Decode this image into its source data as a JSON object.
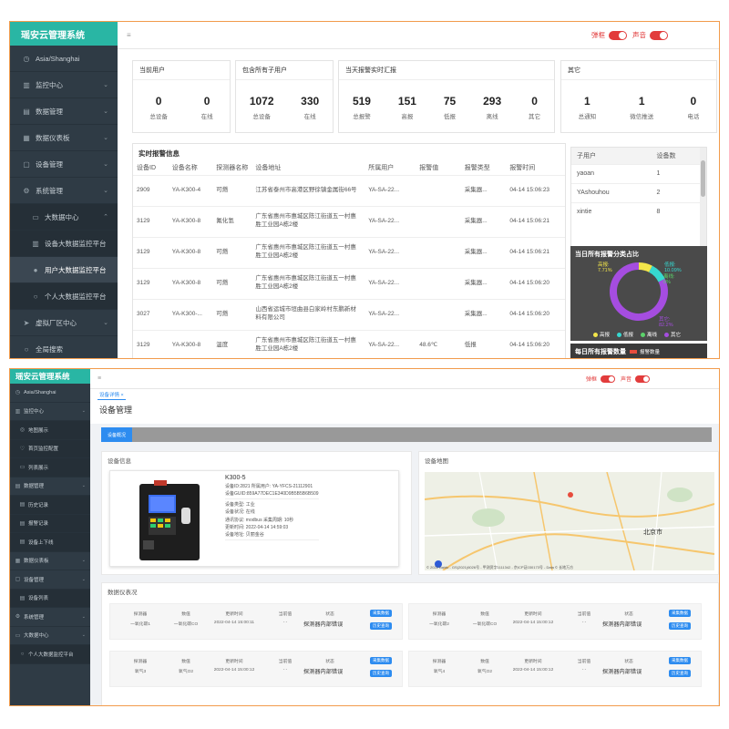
{
  "app": {
    "logo": "瑶安云管理系统"
  },
  "s1": {
    "sidebar": [
      {
        "icon": "◷",
        "label": "Asia/Shanghai",
        "chev": ""
      },
      {
        "icon": "▥",
        "label": "监控中心",
        "chev": "⌄"
      },
      {
        "icon": "▤",
        "label": "数据管理",
        "chev": "⌄"
      },
      {
        "icon": "▦",
        "label": "数据仪表板",
        "chev": "⌄"
      },
      {
        "icon": "▢",
        "label": "设备管理",
        "chev": "⌄"
      },
      {
        "icon": "⚙",
        "label": "系统管理",
        "chev": "⌄"
      },
      {
        "icon": "▭",
        "label": "大数据中心",
        "chev": "⌃"
      },
      {
        "icon": "▥",
        "label": "设备大数据监控平台",
        "chev": ""
      },
      {
        "icon": "●",
        "label": "用户大数据监控平台",
        "chev": ""
      },
      {
        "icon": "○",
        "label": "个人大数据监控平台",
        "chev": ""
      },
      {
        "icon": "➤",
        "label": "虚拟厂区中心",
        "chev": "⌄"
      },
      {
        "icon": "○",
        "label": "全局搜索",
        "chev": ""
      }
    ],
    "top": {
      "popup": "弹框",
      "sound": "声音"
    },
    "cards": [
      {
        "title": "当前用户",
        "stats": [
          {
            "n": "0",
            "l": "总设备"
          },
          {
            "n": "0",
            "l": "在线"
          }
        ]
      },
      {
        "title": "包含所有子用户",
        "stats": [
          {
            "n": "1072",
            "l": "总设备"
          },
          {
            "n": "330",
            "l": "在线"
          }
        ]
      },
      {
        "title": "当天报警实时汇报",
        "stats": [
          {
            "n": "519",
            "l": "总报警"
          },
          {
            "n": "151",
            "l": "高报"
          },
          {
            "n": "75",
            "l": "低报"
          },
          {
            "n": "293",
            "l": "离线"
          },
          {
            "n": "0",
            "l": "其它"
          }
        ]
      },
      {
        "title": "其它",
        "stats": [
          {
            "n": "1",
            "l": "总通知"
          },
          {
            "n": "1",
            "l": "微信推送"
          },
          {
            "n": "0",
            "l": "电话"
          }
        ]
      }
    ],
    "realtime": {
      "title": "实时报警信息",
      "headers": [
        "设备ID",
        "设备名称",
        "探测器名称",
        "设备地址",
        "所属用户",
        "报警值",
        "报警类型",
        "报警时间"
      ],
      "rows": [
        [
          "2909",
          "YA-K300-4",
          "可燃",
          "江苏省泰州市高港区野徐镇金属街66号",
          "YA-SA-22...",
          "",
          "采集器...",
          "04-14 15:06:23"
        ],
        [
          "3129",
          "YA-K300-8",
          "氟化氢",
          "广东省惠州市惠城区陈江街道五一村惠胜工业园A栋2楼",
          "YA-SA-22...",
          "",
          "采集器...",
          "04-14 15:06:21"
        ],
        [
          "3129",
          "YA-K300-8",
          "可燃",
          "广东省惠州市惠城区陈江街道五一村惠胜工业园A栋2楼",
          "YA-SA-22...",
          "",
          "采集器...",
          "04-14 15:06:21"
        ],
        [
          "3129",
          "YA-K300-8",
          "可燃",
          "广东省惠州市惠城区陈江街道五一村惠胜工业园A栋2楼",
          "YA-SA-22...",
          "",
          "采集器...",
          "04-14 15:06:20"
        ],
        [
          "3027",
          "YA-K300-...",
          "可燃",
          "山西省运城市垣曲县白家岭村东鹏新材料有限公司",
          "YA-SA-22...",
          "",
          "采集器...",
          "04-14 15:06:20"
        ],
        [
          "3129",
          "YA-K300-8",
          "温度",
          "广东省惠州市惠城区陈江街道五一村惠胜工业园A栋2楼",
          "YA-SA-22...",
          "48.6℃",
          "低报",
          "04-14 15:06:20"
        ]
      ]
    },
    "users": {
      "headers": [
        "子用户",
        "设备数"
      ],
      "rows": [
        [
          "yaoan",
          "1"
        ],
        [
          "YAshouhou",
          "2"
        ],
        [
          "xintie",
          "8"
        ]
      ]
    },
    "donut": {
      "title": "当日所有报警分类占比",
      "labels": [
        {
          "t": "高报:",
          "v": "7.71%"
        },
        {
          "t": "低报:",
          "v": "10.09%"
        },
        {
          "t": "离线:",
          "v": "0%"
        },
        {
          "t": "其它:",
          "v": "82.2%"
        }
      ],
      "legend": [
        "高报",
        "低报",
        "离线",
        "其它"
      ],
      "colors": [
        "#f3e64a",
        "#36d8d0",
        "#5bd36a",
        "#a54de0"
      ],
      "values": [
        7.71,
        10.09,
        0,
        82.2
      ]
    },
    "bottom_title": "每日所有报警数量",
    "bottom_legend": "报警数量"
  },
  "s2": {
    "sidebar": [
      {
        "icon": "◷",
        "label": "Asia/Shanghai",
        "chev": ""
      },
      {
        "icon": "▥",
        "label": "监控中心",
        "chev": "⌄"
      },
      {
        "icon": "◎",
        "label": "地图展示",
        "chev": ""
      },
      {
        "icon": "♡",
        "label": "首页监控配置",
        "chev": ""
      },
      {
        "icon": "▭",
        "label": "列表展示",
        "chev": ""
      },
      {
        "icon": "▤",
        "label": "数据管理",
        "chev": "⌄"
      },
      {
        "icon": "▤",
        "label": "历史记录",
        "chev": ""
      },
      {
        "icon": "▤",
        "label": "报警记录",
        "chev": ""
      },
      {
        "icon": "▤",
        "label": "设备上下线",
        "chev": ""
      },
      {
        "icon": "▦",
        "label": "数据仪表板",
        "chev": "⌄"
      },
      {
        "icon": "▢",
        "label": "设备管理",
        "chev": "⌄"
      },
      {
        "icon": "▤",
        "label": "设备列表",
        "chev": ""
      },
      {
        "icon": "⚙",
        "label": "系统管理",
        "chev": "⌄"
      },
      {
        "icon": "▭",
        "label": "大数据中心",
        "chev": "⌄"
      },
      {
        "icon": "○",
        "label": "个人大数据监控平台",
        "chev": ""
      }
    ],
    "top": {
      "popup": "弹框",
      "sound": "声音"
    },
    "tab": "设备详情 ×",
    "page_title": "设备管理",
    "sub_tab": "设备概况",
    "device_info": {
      "title": "设备信息",
      "name": "K300-5",
      "lines": [
        "设备ID:2821    所属用户: YA-YFCS-21112901",
        "设备GUID:859A77DEC1E340D9B5B5B6B509",
        "设备类型: 工业",
        "设备状况: 在线",
        "通讯协议: modbus    采集周期: 10秒",
        "更新时间: 2022-04-14 14:59:03",
        "设备地址: 贝丽金谷"
      ]
    },
    "map": {
      "title": "设备地图",
      "label": "北京市",
      "copyright": "© 2022 Baidu - GS(2021)6026号 - 甲测资字1111342 - 京ICP证030173号 - Data © 长地万方"
    },
    "data_title": "数据仪表况",
    "records": [
      {
        "h": [
          "探测器",
          "数值",
          "更新时间",
          "当前值",
          "状态"
        ],
        "v": [
          "一氧化碳1",
          "一氧化碳CO",
          "2022-04-14 15:00:11",
          "- -",
          "探测器内部错误"
        ],
        "b": [
          "采集数据",
          "历史查询"
        ]
      },
      {
        "h": [
          "探测器",
          "数值",
          "更新时间",
          "当前值",
          "状态"
        ],
        "v": [
          "一氧化碳2",
          "一氧化碳CO",
          "2022-04-14 15:00:12",
          "- -",
          "探测器内部错误"
        ],
        "b": [
          "采集数据",
          "历史查询"
        ]
      },
      {
        "h": [
          "探测器",
          "数值",
          "更新时间",
          "当前值",
          "状态"
        ],
        "v": [
          "氧气3",
          "氧气O2",
          "2022-04-14 15:00:12",
          "- -",
          "探测器内部错误"
        ],
        "b": [
          "采集数据",
          "历史查询"
        ]
      },
      {
        "h": [
          "探测器",
          "数值",
          "更新时间",
          "当前值",
          "状态"
        ],
        "v": [
          "氧气4",
          "氧气O2",
          "2022-04-14 15:00:12",
          "- -",
          "探测器内部错误"
        ],
        "b": [
          "采集数据",
          "历史查询"
        ]
      }
    ]
  }
}
